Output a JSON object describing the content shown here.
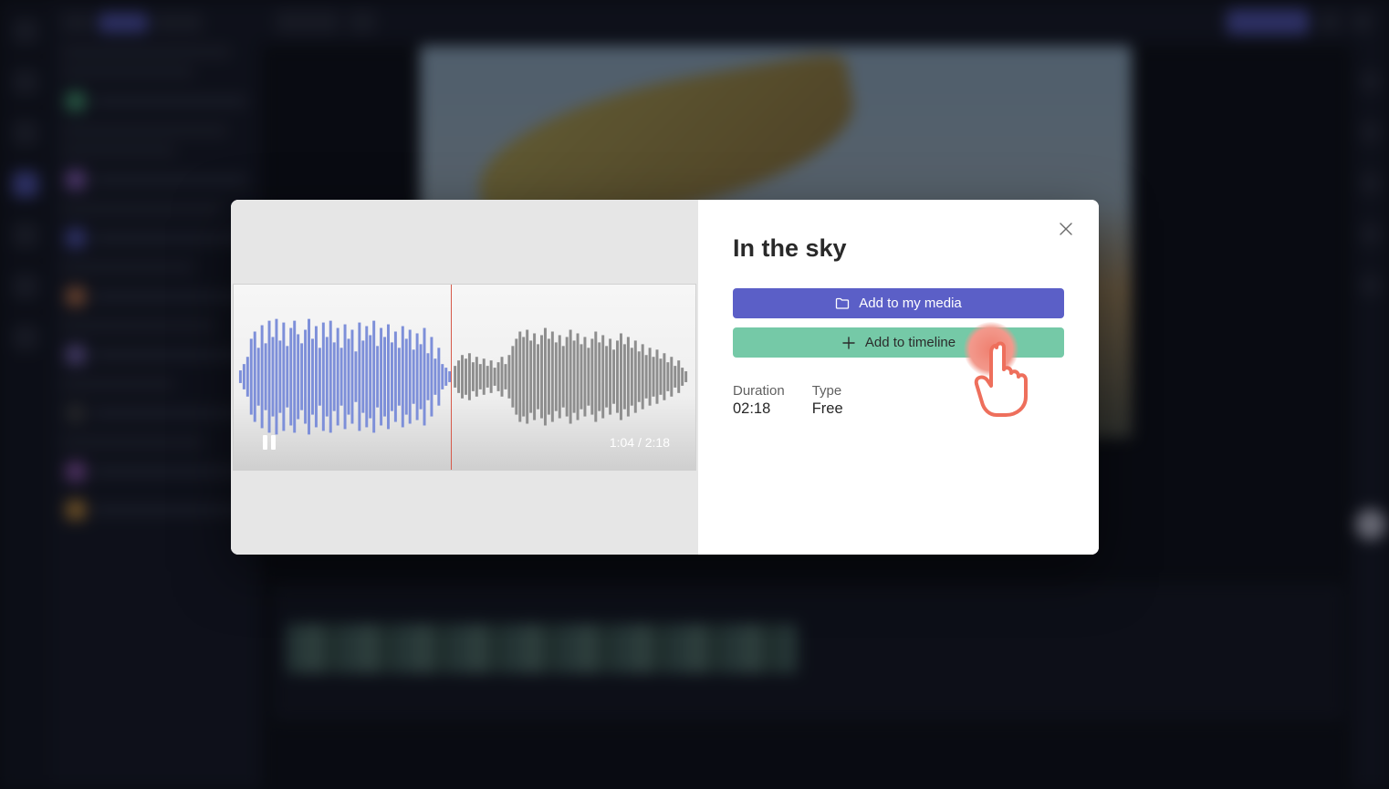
{
  "modal": {
    "title": "In the sky",
    "add_to_media_label": "Add to my media",
    "add_to_timeline_label": "Add to timeline",
    "time_current": "1:04",
    "time_total": "2:18",
    "timecode_display": "1:04 / 2:18",
    "playhead_position_pct": 47,
    "meta": {
      "duration_label": "Duration",
      "duration_value": "02:18",
      "type_label": "Type",
      "type_value": "Free"
    }
  },
  "colors": {
    "button_primary": "#5b5fc7",
    "button_secondary": "#75c9a7",
    "playhead": "#d65a4a",
    "pointer": "#f08070"
  },
  "icons": {
    "close": "close-icon",
    "folder": "folder-icon",
    "plus": "plus-icon",
    "pause": "pause-icon",
    "pointer": "pointer-hand-icon"
  },
  "background_editor": {
    "preview_hint": "blurred video preview",
    "sidebar_items": 7,
    "panel_items": 8,
    "top_export_button": "Export"
  }
}
